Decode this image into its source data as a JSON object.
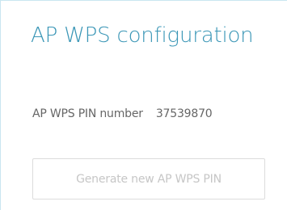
{
  "panel": {
    "title": "AP WPS configuration",
    "pin_label": "AP WPS PIN number",
    "pin_value": "37539870",
    "generate_button_label": "Generate new AP WPS PIN"
  },
  "colors": {
    "title": "#3a96b6",
    "text": "#666666",
    "button_text_disabled": "#c6c6c6",
    "button_border": "#dcdcdc",
    "panel_border": "#c9e6f0"
  }
}
